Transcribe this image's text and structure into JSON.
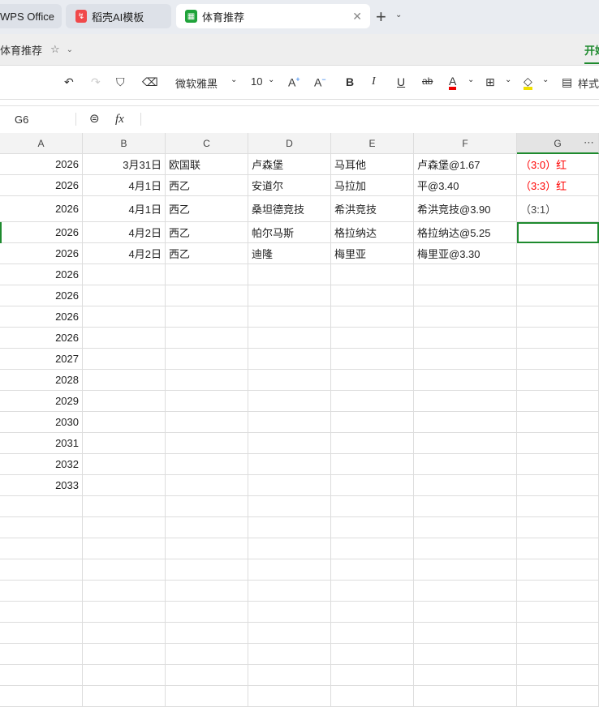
{
  "tabs": [
    {
      "label": "WPS Office"
    },
    {
      "label": "稻壳AI模板"
    },
    {
      "label": "体育推荐"
    }
  ],
  "doc_title": "体育推荐",
  "ribbon_tab": "开始",
  "toolbar": {
    "font": "微软雅黑",
    "size": "10",
    "style_label": "样式"
  },
  "cell_ref": "G6",
  "fx": "fx",
  "columns": [
    "A",
    "B",
    "C",
    "D",
    "E",
    "F",
    "G"
  ],
  "rows": [
    [
      "2026",
      "3月31日",
      "欧国联",
      "卢森堡",
      "马耳他",
      "卢森堡@1.67",
      "（3:0）红"
    ],
    [
      "2026",
      "4月1日",
      "西乙",
      "安道尔",
      "马拉加",
      "平@3.40",
      "（3:3）红"
    ],
    [
      "2026",
      "4月1日",
      "西乙",
      "桑坦德竞技",
      "希洪竞技",
      "希洪竞技@3.90",
      "（3:1）"
    ],
    [
      "2026",
      "4月2日",
      "西乙",
      "帕尔马斯",
      "格拉纳达",
      "格拉纳达@5.25",
      ""
    ],
    [
      "2026",
      "4月2日",
      "西乙",
      "迪隆",
      "梅里亚",
      "梅里亚@3.30",
      ""
    ],
    [
      "2026",
      "",
      "",
      "",
      "",
      "",
      ""
    ],
    [
      "2026",
      "",
      "",
      "",
      "",
      "",
      ""
    ],
    [
      "2026",
      "",
      "",
      "",
      "",
      "",
      ""
    ],
    [
      "2026",
      "",
      "",
      "",
      "",
      "",
      ""
    ],
    [
      "2027",
      "",
      "",
      "",
      "",
      "",
      ""
    ],
    [
      "2028",
      "",
      "",
      "",
      "",
      "",
      ""
    ],
    [
      "2029",
      "",
      "",
      "",
      "",
      "",
      ""
    ],
    [
      "2030",
      "",
      "",
      "",
      "",
      "",
      ""
    ],
    [
      "2031",
      "",
      "",
      "",
      "",
      "",
      ""
    ],
    [
      "2032",
      "",
      "",
      "",
      "",
      "",
      ""
    ],
    [
      "2033",
      "",
      "",
      "",
      "",
      "",
      ""
    ]
  ],
  "colors": {
    "accent": "#1e8a2e",
    "red": "#ff0000"
  }
}
